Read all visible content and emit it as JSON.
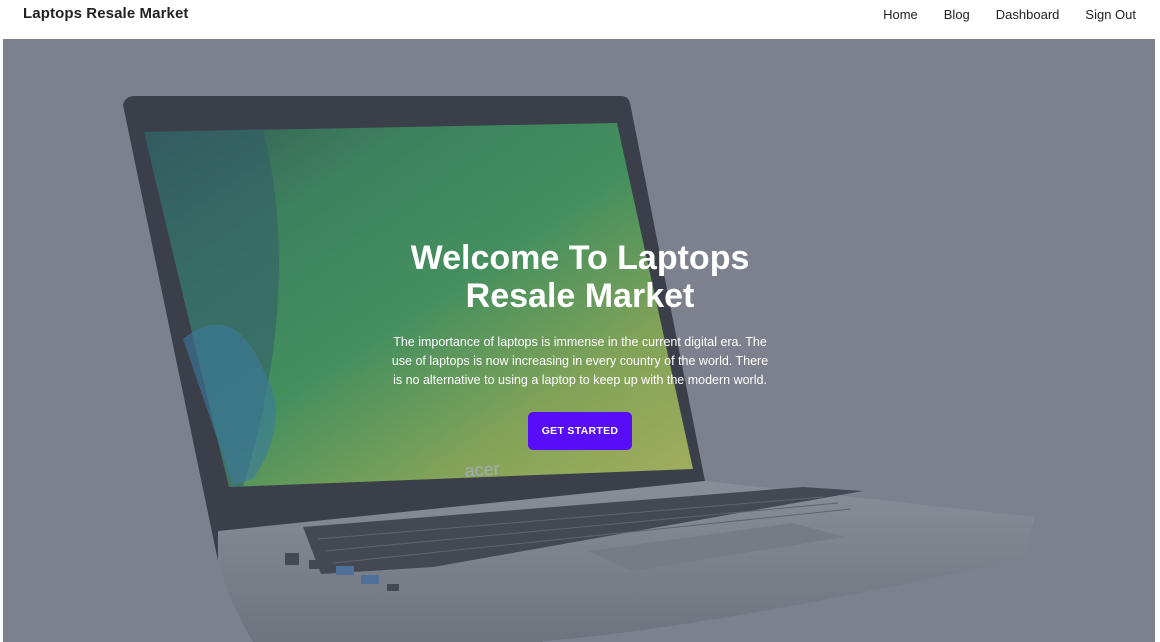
{
  "navbar": {
    "brand": "Laptops Resale Market",
    "links": [
      "Home",
      "Blog",
      "Dashboard",
      "Sign Out"
    ]
  },
  "hero": {
    "title": "Welcome To Laptops Resale Market",
    "description": "The importance of laptops is immense in the current digital era. The use of laptops is now increasing in every country of the world. There is no alternative to using a laptop to keep up with the modern world.",
    "cta_label": "GET STARTED",
    "laptop_logo": "acer"
  },
  "colors": {
    "hero_background": "#868a95",
    "cta_background": "#570df8",
    "nav_text": "#222222"
  }
}
